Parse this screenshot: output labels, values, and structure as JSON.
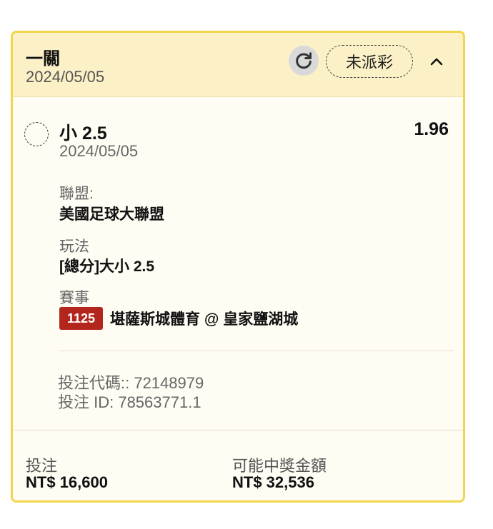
{
  "header": {
    "bet_type": "一關",
    "date": "2024/05/05",
    "status": "未派彩",
    "icons": {
      "refresh": "refresh-icon",
      "collapse": "chevron-up-icon"
    }
  },
  "selection": {
    "name": "小 2.5",
    "odds": "1.96",
    "date": "2024/05/05"
  },
  "details": {
    "league_label": "聯盟:",
    "league_value": "美國足球大聯盟",
    "market_label": "玩法",
    "market_value": "[總分]大小 2.5",
    "event_label": "賽事",
    "event_badge": "1125",
    "event_value": "堪薩斯城體育 @ 皇家鹽湖城"
  },
  "meta": {
    "bet_code": "投注代碼:: 72148979",
    "bet_id": "投注 ID: 78563771.1"
  },
  "footer": {
    "stake_label": "投注",
    "stake_value": "NT$ 16,600",
    "payout_label": "可能中獎金額",
    "payout_value": "NT$ 32,536"
  },
  "colors": {
    "border": "#f2d64a",
    "header_bg": "#fbf0c6",
    "card_bg": "#fffcf3",
    "badge_bg": "#b3261e"
  }
}
